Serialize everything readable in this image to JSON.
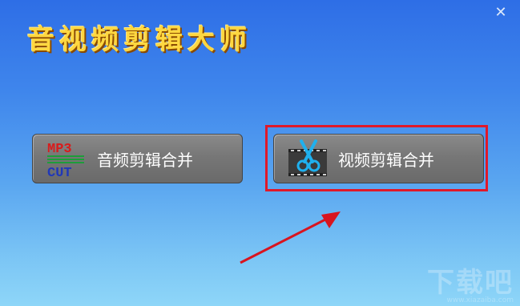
{
  "window": {
    "title": "音视频剪辑大师",
    "close_icon": "close-icon"
  },
  "buttons": {
    "audio": {
      "label": "音频剪辑合并",
      "icon": "mp3-cut-icon",
      "icon_text_top": "MP3",
      "icon_text_bottom": "CUT"
    },
    "video": {
      "label": "视频剪辑合并",
      "icon": "film-scissors-icon"
    }
  },
  "annotation": {
    "highlight_color": "#e0192a",
    "arrow_color": "#d8141f"
  },
  "watermark": {
    "logo": "下载吧",
    "url": "www.xiazaiba.com"
  }
}
